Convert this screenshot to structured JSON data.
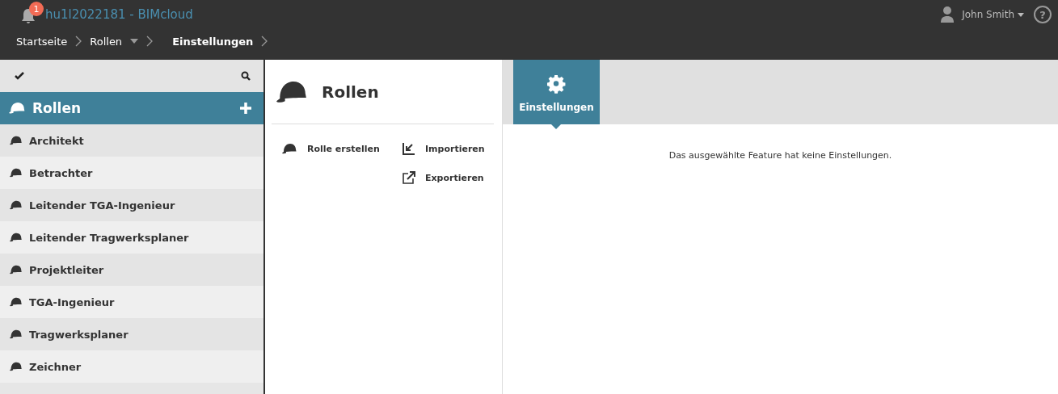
{
  "header": {
    "notification_count": "1",
    "title": "hu1l2022181 - BIMcloud",
    "user": "John Smith",
    "help": "?"
  },
  "breadcrumbs": [
    {
      "label": "Startseite",
      "dropdown": false,
      "current": false
    },
    {
      "label": "Rollen",
      "dropdown": true,
      "current": false
    },
    {
      "label": "Einstellungen",
      "dropdown": false,
      "current": true
    }
  ],
  "sidebar": {
    "title": "Rollen",
    "items": [
      {
        "label": "Architekt"
      },
      {
        "label": "Betrachter"
      },
      {
        "label": "Leitender TGA-Ingenieur"
      },
      {
        "label": "Leitender Tragwerksplaner"
      },
      {
        "label": "Projektleiter"
      },
      {
        "label": "TGA-Ingenieur"
      },
      {
        "label": "Tragwerksplaner"
      },
      {
        "label": "Zeichner"
      }
    ]
  },
  "detail": {
    "title": "Rollen",
    "actions": [
      {
        "kind": "create",
        "label": "Rolle erstellen"
      },
      {
        "kind": "import",
        "label": "Importieren"
      },
      {
        "kind": "export",
        "label": "Exportieren"
      }
    ]
  },
  "tabs": [
    {
      "label": "Einstellungen",
      "selected": true
    }
  ],
  "message": "Das ausgewählte Feature hat keine Einstellungen."
}
